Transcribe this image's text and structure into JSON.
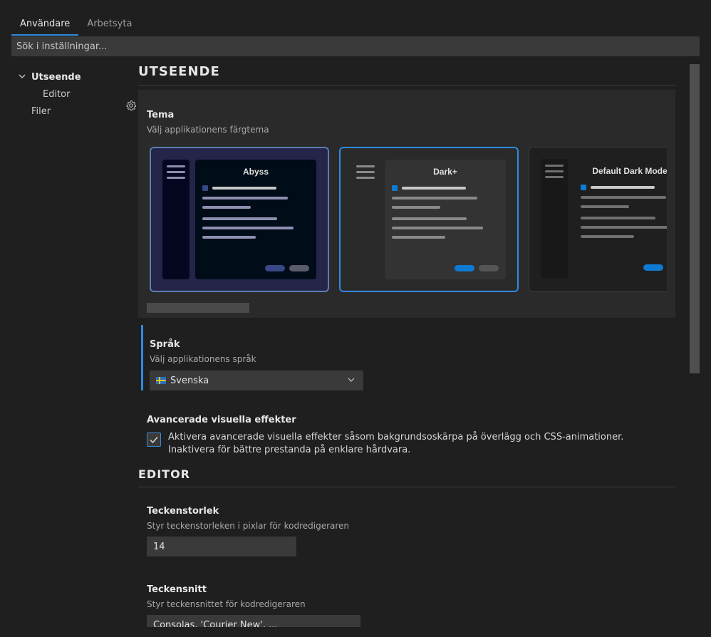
{
  "tabs": [
    {
      "label": "Användare",
      "active": true
    },
    {
      "label": "Arbetsyta",
      "active": false
    }
  ],
  "search": {
    "placeholder": "Sök i inställningar..."
  },
  "toc": {
    "items": [
      {
        "label": "Utseende",
        "expanded": true
      },
      {
        "label": "Editor"
      },
      {
        "label": "Filer"
      }
    ]
  },
  "sections": {
    "utseende": "UTSEENDE",
    "editor": "EDITOR"
  },
  "tema": {
    "title": "Tema",
    "description": "Välj applikationens färgtema",
    "themes": [
      {
        "name": "Abyss",
        "selected": false,
        "bg": "#25254a",
        "panel": "#000c18",
        "side": "#060621",
        "accent": "#384887",
        "line": "#8d8fb0",
        "btn2": "#5b5b6e"
      },
      {
        "name": "Dark+",
        "selected": true,
        "bg": "#2a2a2a",
        "panel": "#333333",
        "side": "#2a2a2a",
        "accent": "#0e7ad1",
        "line": "#8a8a8a",
        "btn2": "#555555"
      },
      {
        "name": "Default Dark Modern",
        "selected": false,
        "bg": "#1f1f1f",
        "panel": "#1f1f1f",
        "side": "#181818",
        "accent": "#0e7ad1",
        "line": "#707070",
        "btn2": "#444444"
      }
    ]
  },
  "sprak": {
    "title": "Språk",
    "description": "Välj applikationens språk",
    "value": "Svenska"
  },
  "avancerade": {
    "title": "Avancerade visuella effekter",
    "checked": true,
    "label": "Aktivera avancerade visuella effekter såsom bakgrundsoskärpa på överlägg och CSS-animationer. Inaktivera för bättre prestanda på enklare hårdvara."
  },
  "teckenstorlek": {
    "title": "Teckenstorlek",
    "description": "Styr teckenstorleken i pixlar för kodredigeraren",
    "value": "14"
  },
  "teckensnitt": {
    "title": "Teckensnitt",
    "description": "Styr teckensnittet för kodredigeraren",
    "value": "Consolas, 'Courier New', ..."
  },
  "colors": {
    "accent": "#2f8ae0",
    "background": "#1f1f1f",
    "input": "#3a3a3a"
  }
}
